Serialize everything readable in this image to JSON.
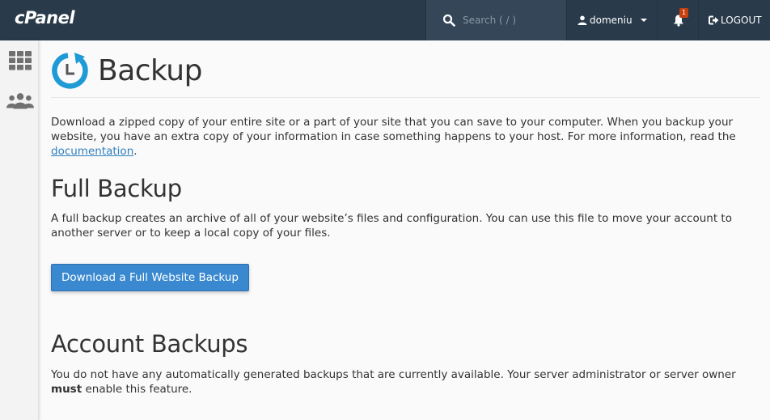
{
  "header": {
    "logo": "cPanel",
    "search_placeholder": "Search ( / )",
    "username": "domeniu",
    "notification_count": "1",
    "logout_label": "LOGOUT"
  },
  "sidebar": {
    "items": [
      {
        "name": "home-grid",
        "icon": "grid-icon"
      },
      {
        "name": "users",
        "icon": "users-icon"
      }
    ]
  },
  "page": {
    "title": "Backup",
    "title_icon": "backup-clock-icon",
    "intro_text": "Download a zipped copy of your entire site or a part of your site that you can save to your computer. When you backup your website, you have an extra copy of your information in case something happens to your host. For more information, read the ",
    "intro_link": "documentation",
    "intro_end": ".",
    "full_backup": {
      "heading": "Full Backup",
      "description": "A full backup creates an archive of all of your website’s files and configuration. You can use this file to move your account to another server or to keep a local copy of your files.",
      "button_label": "Download a Full Website Backup"
    },
    "account_backups": {
      "heading": "Account Backups",
      "description_start": "You do not have any automatically generated backups that are currently available. Your server administrator or server owner ",
      "description_bold": "must",
      "description_end": " enable this feature."
    }
  },
  "colors": {
    "topbar": "#293a4a",
    "accent": "#3a89d0",
    "icon_blue": "#1e9ad6",
    "badge": "#c5400f",
    "link": "#2f7fbf"
  }
}
